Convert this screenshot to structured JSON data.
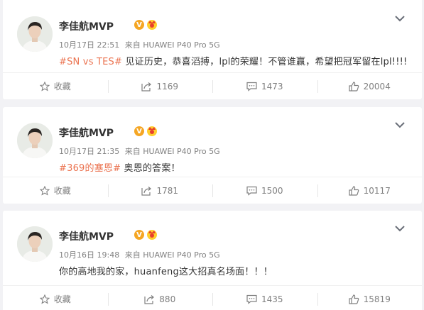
{
  "posts": [
    {
      "author": "李佳航MVP",
      "verified_badge": "V",
      "date": "10月17日 22:51",
      "source": "来自 HUAWEI P40 Pro 5G",
      "tag": "#SN vs TES#",
      "text": " 见证历史，恭喜滔搏，lpl的荣耀！不管谁赢，希望把冠军留在lpl!!!!",
      "actions": {
        "favorite": "收藏",
        "repost": "1169",
        "comment": "1473",
        "like": "20004"
      }
    },
    {
      "author": "李佳航MVP",
      "verified_badge": "V",
      "date": "10月17日 21:35",
      "source": "来自 HUAWEI P40 Pro 5G",
      "tag": "#369的塞恩#",
      "text": " 奥恩的答案！",
      "actions": {
        "favorite": "收藏",
        "repost": "1781",
        "comment": "1500",
        "like": "10117"
      }
    },
    {
      "author": "李佳航MVP",
      "verified_badge": "V",
      "date": "10月16日 19:48",
      "source": "来自 HUAWEI P40 Pro 5G",
      "tag": "",
      "text": "你的高地我的家，huanfeng这大招真名场面！！！",
      "actions": {
        "favorite": "收藏",
        "repost": "880",
        "comment": "1435",
        "like": "15819"
      }
    }
  ],
  "colors": {
    "tag": "#eb7350",
    "badge": "#f5a623",
    "muted": "#808080",
    "text": "#333333"
  }
}
